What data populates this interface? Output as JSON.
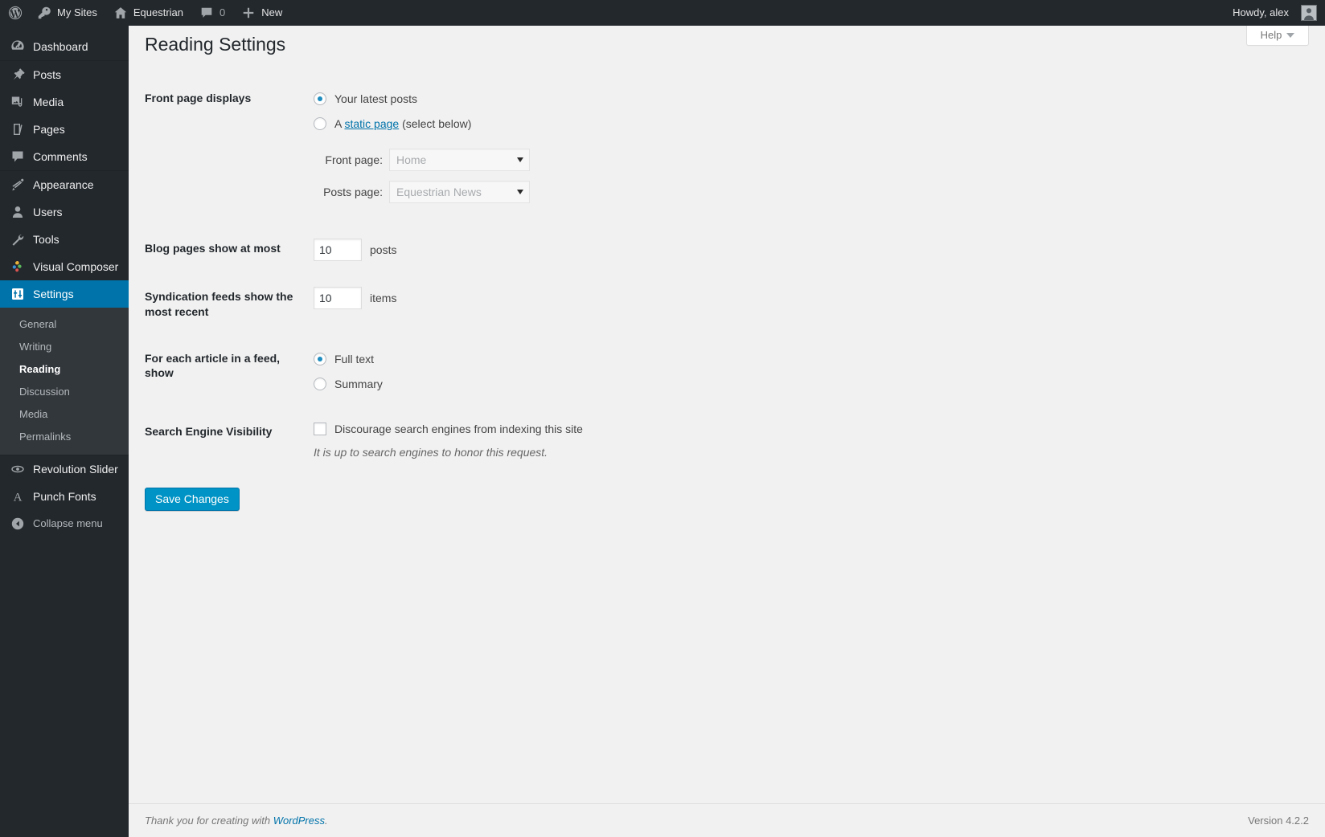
{
  "adminbar": {
    "logo_icon": "wordpress-logo-icon",
    "left_items": [
      {
        "icon": "key-icon",
        "label": "My Sites"
      },
      {
        "icon": "home-icon",
        "label": "Equestrian"
      },
      {
        "icon": "comment-bubble-icon",
        "label": "0"
      },
      {
        "icon": "plus-icon",
        "label": "New"
      }
    ],
    "my_sites_label": "My Sites",
    "site_label": "Equestrian",
    "comments_count": "0",
    "new_label": "New",
    "howdy": "Howdy, alex"
  },
  "sidebar": {
    "groups": [
      {
        "items": [
          {
            "label": "Dashboard",
            "icon": "dashboard-icon",
            "key": "dashboard"
          }
        ]
      },
      {
        "items": [
          {
            "label": "Posts",
            "icon": "pin-icon",
            "key": "posts"
          },
          {
            "label": "Media",
            "icon": "media-icon",
            "key": "media"
          },
          {
            "label": "Pages",
            "icon": "pages-icon",
            "key": "pages"
          },
          {
            "label": "Comments",
            "icon": "comments-icon",
            "key": "comments"
          }
        ]
      },
      {
        "items": [
          {
            "label": "Appearance",
            "icon": "appearance-brush-icon",
            "key": "appearance"
          },
          {
            "label": "Users",
            "icon": "users-icon",
            "key": "users"
          },
          {
            "label": "Tools",
            "icon": "tools-wrench-icon",
            "key": "tools"
          },
          {
            "label": "Visual Composer",
            "icon": "visual-composer-icon",
            "key": "visual-composer"
          },
          {
            "label": "Settings",
            "icon": "settings-sliders-icon",
            "key": "settings",
            "current": true
          }
        ]
      },
      {
        "items": [
          {
            "label": "Revolution Slider",
            "icon": "revolution-slider-icon",
            "key": "revolution-slider"
          },
          {
            "label": "Punch Fonts",
            "icon": "punch-fonts-a-icon",
            "key": "punch-fonts"
          }
        ]
      }
    ],
    "settings_submenu": [
      {
        "label": "General",
        "current": false
      },
      {
        "label": "Writing",
        "current": false
      },
      {
        "label": "Reading",
        "current": true
      },
      {
        "label": "Discussion",
        "current": false
      },
      {
        "label": "Media",
        "current": false
      },
      {
        "label": "Permalinks",
        "current": false
      }
    ],
    "collapse_label": "Collapse menu",
    "collapse_icon": "collapse-arrow-icon"
  },
  "screen_meta": {
    "help_label": "Help",
    "help_caret_icon": "caret-down-icon"
  },
  "page": {
    "title": "Reading Settings"
  },
  "form": {
    "front_page_displays": {
      "label": "Front page displays",
      "option_latest": "Your latest posts",
      "option_static_prefix": "A ",
      "option_static_link": "static page",
      "option_static_suffix": " (select below)",
      "selected": "latest",
      "front_page_label": "Front page:",
      "front_page_value": "Home",
      "posts_page_label": "Posts page:",
      "posts_page_value": "Equestrian News",
      "caret_icon": "select-caret-icon"
    },
    "blog_pages": {
      "label": "Blog pages show at most",
      "value": "10",
      "unit": "posts"
    },
    "syndication": {
      "label": "Syndication feeds show the most recent",
      "value": "10",
      "unit": "items"
    },
    "feed_article": {
      "label": "For each article in a feed, show",
      "option_full": "Full text",
      "option_summary": "Summary",
      "selected": "full"
    },
    "search_visibility": {
      "label": "Search Engine Visibility",
      "checkbox_label": "Discourage search engines from indexing this site",
      "checked": false,
      "note": "It is up to search engines to honor this request."
    },
    "submit_label": "Save Changes"
  },
  "footer": {
    "thanks_prefix": "Thank you for creating with ",
    "thanks_link": "WordPress",
    "thanks_suffix": ".",
    "version": "Version 4.2.2"
  },
  "colors": {
    "admin_dark": "#23282d",
    "submenu_bg": "#32373c",
    "accent_blue": "#0073aa",
    "button_blue": "#0093c5",
    "link_blue": "#0073aa",
    "content_bg": "#f1f1f1"
  }
}
